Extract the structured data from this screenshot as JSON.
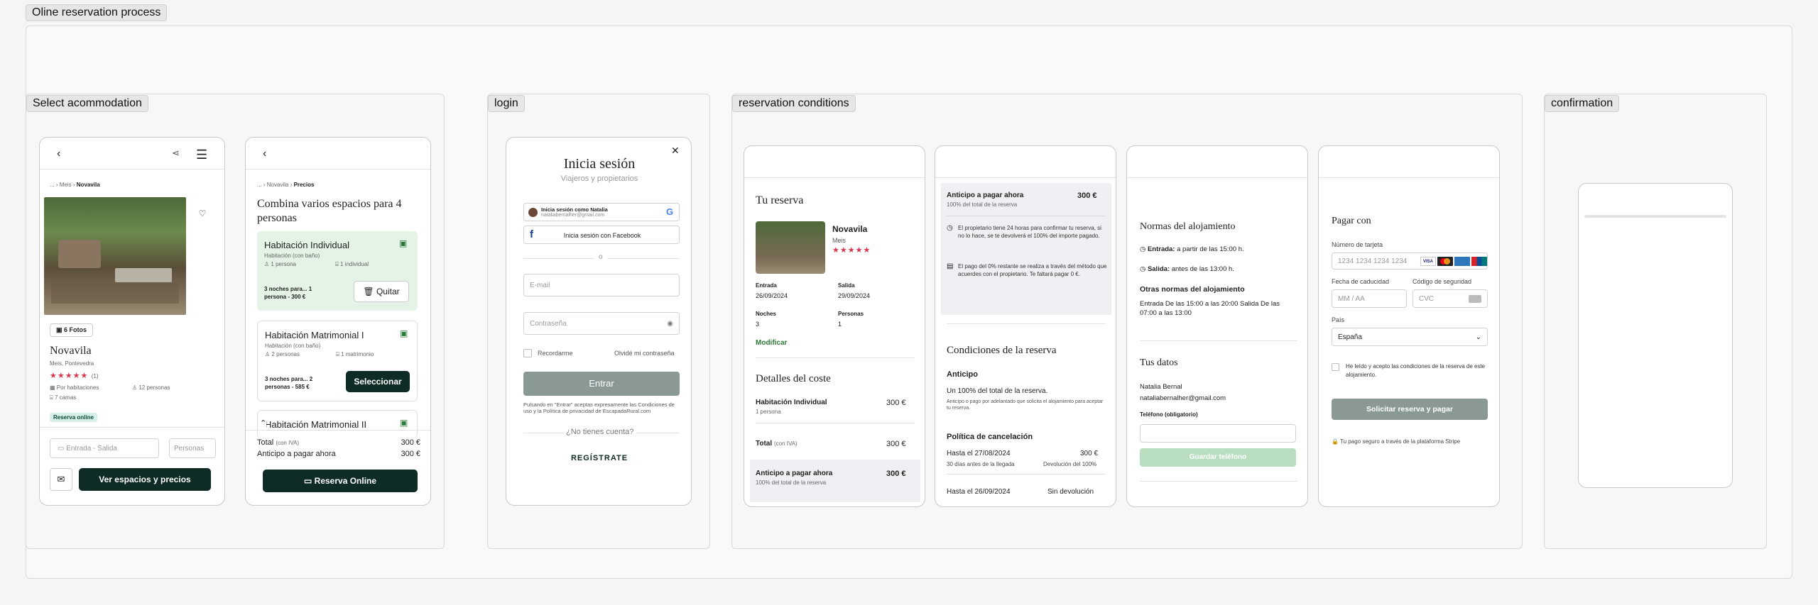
{
  "outer": {
    "title": "Oline reservation process"
  },
  "sections": {
    "select": "Select acommodation",
    "login": "login",
    "conditions": "reservation conditions",
    "confirmation": "confirmation"
  },
  "s1": {
    "breadcrumb": {
      "c1": "...",
      "c2": "Meis",
      "c3": "Novavila"
    },
    "photos_label": "6 Fotos",
    "name": "Novavila",
    "location": "Meis, Pontevedra",
    "stars": "★★★★★",
    "rating_count": "(1)",
    "feat1": "Por habitaciones",
    "feat2": "12 personas",
    "feat3": "7 camas",
    "badge": "Reserva online",
    "dates_placeholder": "Entrada - Salida",
    "persons_placeholder": "Personas",
    "cta": "Ver espacios y precios"
  },
  "s2": {
    "breadcrumb": {
      "c1": "...",
      "c2": "Novavila",
      "c3": "Precios"
    },
    "title": "Combina varios espacios para 4 personas",
    "room1": {
      "name": "Habitación Individual",
      "sub": "Habitación (con baño)",
      "p": "1 persona",
      "b": "1 individual",
      "price": "3 noches para... 1 persona - 300 €",
      "action": "Quitar"
    },
    "room2": {
      "name": "Habitación Matrimonial I",
      "sub": "Habitación (con baño)",
      "p": "2 personas",
      "b": "1 matrimonio",
      "price": "3 noches para... 2 personas - 585 €",
      "action": "Seleccionar"
    },
    "room3": {
      "name": "Habitación Matrimonial II"
    },
    "total_label": "Total",
    "total_iva": "(con IVA)",
    "total_value": "300 €",
    "anticipo_label": "Anticipo a pagar ahora",
    "anticipo_value": "300 €",
    "cta": "Reserva Online"
  },
  "login": {
    "title": "Inicia sesión",
    "subtitle": "Viajeros y propietarios",
    "google_name": "Inicia sesión como Natalia",
    "google_email": "nataliabernalher@gmail.com",
    "facebook": "Inicia sesión con Facebook",
    "or": "o",
    "email_ph": "E-mail",
    "password_ph": "Contraseña",
    "remember": "Recordarme",
    "forgot": "Olvidé mi contraseña",
    "enter": "Entrar",
    "legal": "Pulsando en \"Entrar\" aceptas expresamente las Condiciones de uso y la Política de privacidad de EscapadaRural.com",
    "no_account": "¿No tienes cuenta?",
    "register": "REGÍSTRATE"
  },
  "c1": {
    "title": "Tu reserva",
    "name": "Novavila",
    "place": "Meis",
    "stars": "★★★★★",
    "entrada_l": "Entrada",
    "entrada_v": "26/09/2024",
    "salida_l": "Salida",
    "salida_v": "29/09/2024",
    "noches_l": "Noches",
    "noches_v": "3",
    "personas_l": "Personas",
    "personas_v": "1",
    "modify": "Modificar",
    "cost_title": "Detalles del coste",
    "room": "Habitación Individual",
    "room_sub": "1 persona",
    "room_price": "300 €",
    "total_l": "Total",
    "total_iva": "(con IVA)",
    "total_v": "300 €",
    "ant_l": "Anticipo a pagar ahora",
    "ant_v": "300 €",
    "ant_sub": "100% del total de la reserva"
  },
  "c2": {
    "ant_l": "Anticipo a pagar ahora",
    "ant_v": "300 €",
    "ant_sub": "100% del total de la reserva",
    "info1": "El propietario tiene 24 horas para confirmar tu reserva, si no lo hace, se te devolverá el 100% del importe pagado.",
    "info2": "El pago del 0% restante se realiza a través del método que acuerdes con el propietario. Te faltará pagar 0 €.",
    "cond_title": "Condiciones de la reserva",
    "anticipo_h": "Anticipo",
    "anticipo_t": "Un 100% del total de la reserva.",
    "anticipo_s": "Anticipo o pago por adelantado que solicita el alojamiento para aceptar tu reserva.",
    "cancel_h": "Política de cancelación",
    "c1_date": "Hasta el 27/08/2024",
    "c1_sub": "30 días antes de la llegada",
    "c1_v": "300 €",
    "c1_r": "Devolución del 100%",
    "c2_date": "Hasta el 26/09/2024",
    "c2_v": "Sin devolución"
  },
  "c3": {
    "title": "Normas del alojamiento",
    "entrada_b": "Entrada:",
    "entrada_t": "a partir de las 15:00 h.",
    "salida_b": "Salida:",
    "salida_t": "antes de las 13:00 h.",
    "otras_h": "Otras normas del alojamiento",
    "otras_t": "Entrada De las 15:00 a las 20:00 Salida De las 07:00 a las 13:00",
    "datos_title": "Tus datos",
    "user_name": "Natalia Bernal",
    "user_email": "nataliabernalher@gmail.com",
    "phone_label": "Teléfono (obligatorio)",
    "save_phone": "Guardar teléfono"
  },
  "c4": {
    "title": "Pagar con",
    "card_label": "Número de tarjeta",
    "card_ph": "1234 1234 1234 1234",
    "brands": [
      "VISA",
      "MC",
      "AMEX",
      "UP"
    ],
    "exp_label": "Fecha de caducidad",
    "exp_ph": "MM / AA",
    "cvc_label": "Código de seguridad",
    "cvc_ph": "CVC",
    "country_label": "País",
    "country_value": "España",
    "terms": "He leído y acepto las condiciones de la reserva de este alojamiento.",
    "pay_btn": "Solicitar reserva y pagar",
    "secure": "Tu pago seguro a través de la plataforma Stripe"
  },
  "colors": {
    "brand_dark": "#0f2b26",
    "green_bg": "#e4f3e6",
    "accent_green": "#2c7a3b",
    "stars": "#d9364d"
  }
}
